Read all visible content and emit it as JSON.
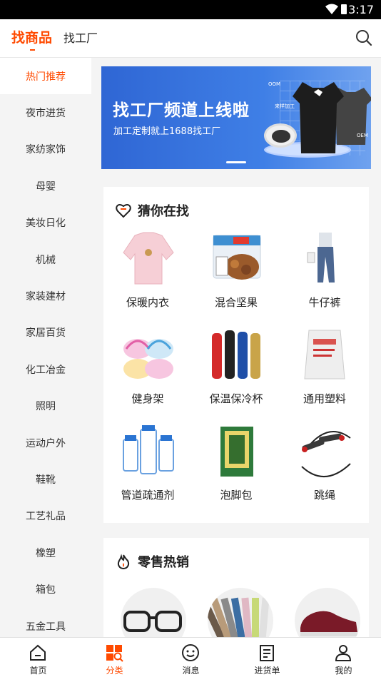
{
  "status_bar": {
    "time": "3:17"
  },
  "header": {
    "tab_active": "找商品",
    "tab_other": "找工厂"
  },
  "sidebar": {
    "items": [
      {
        "label": "热门推荐",
        "active": true
      },
      {
        "label": "夜市进货"
      },
      {
        "label": "家纺家饰"
      },
      {
        "label": "母婴"
      },
      {
        "label": "美妆日化"
      },
      {
        "label": "机械"
      },
      {
        "label": "家装建材"
      },
      {
        "label": "家居百货"
      },
      {
        "label": "化工冶金"
      },
      {
        "label": "照明"
      },
      {
        "label": "运动户外"
      },
      {
        "label": "鞋靴"
      },
      {
        "label": "工艺礼品"
      },
      {
        "label": "橡塑"
      },
      {
        "label": "箱包"
      },
      {
        "label": "五金工具"
      }
    ]
  },
  "banner": {
    "title": "找工厂频道上线啦",
    "subtitle": "加工定制就上1688找工厂",
    "tag_oom": "OOM",
    "tag_sample": "来样加工",
    "tag_oem": "OEM"
  },
  "guess_section": {
    "title": "猜你在找",
    "items": [
      {
        "label": "保暖内衣",
        "icon": "sweater-image"
      },
      {
        "label": "混合坚果",
        "icon": "nuts-image"
      },
      {
        "label": "牛仔裤",
        "icon": "jeans-image"
      },
      {
        "label": "健身架",
        "icon": "baby-gym-image"
      },
      {
        "label": "保温保冷杯",
        "icon": "bottles-image"
      },
      {
        "label": "通用塑料",
        "icon": "plastic-bag-image"
      },
      {
        "label": "管道疏通剂",
        "icon": "cleaner-image"
      },
      {
        "label": "泡脚包",
        "icon": "herbal-pack-image"
      },
      {
        "label": "跳绳",
        "icon": "jump-rope-image"
      }
    ]
  },
  "hot_section": {
    "title": "零售热销",
    "items": [
      {
        "icon": "glasses-image"
      },
      {
        "icon": "socks-image"
      },
      {
        "icon": "shoe-image"
      }
    ]
  },
  "tabbar": {
    "items": [
      {
        "label": "首页",
        "icon": "home-icon"
      },
      {
        "label": "分类",
        "icon": "category-icon",
        "active": true
      },
      {
        "label": "消息",
        "icon": "message-icon"
      },
      {
        "label": "进货单",
        "icon": "order-list-icon"
      },
      {
        "label": "我的",
        "icon": "profile-icon"
      }
    ]
  },
  "colors": {
    "accent": "#ff4a00",
    "banner_blue": "#3570dc"
  }
}
